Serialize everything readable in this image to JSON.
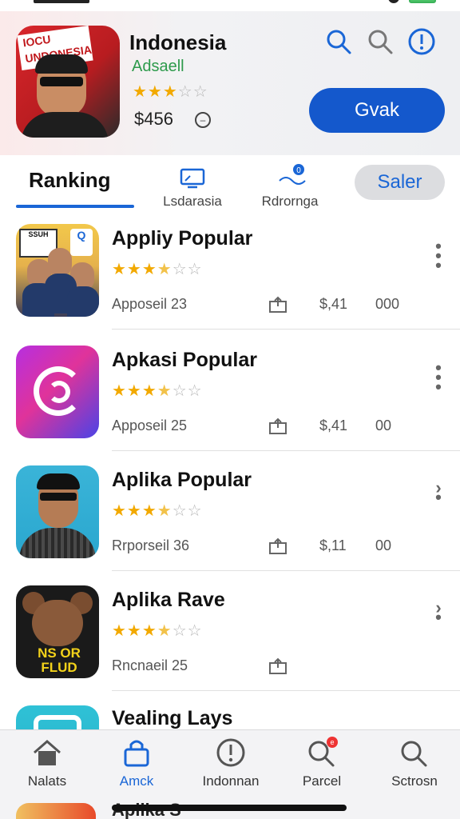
{
  "header": {
    "title": "Indonesia",
    "subtitle": "Adsaell",
    "rating_stars": 3,
    "price": "$456",
    "price_icon": "circle-dash-icon",
    "icon_banner_text": "IOCU UNDONESIA",
    "get_button": "Gvak",
    "icons": [
      "search-icon",
      "search-outline-icon",
      "info-icon"
    ],
    "accent": "#1458cc"
  },
  "tabs": {
    "ranking": "Ranking",
    "tab2": "Lsdarasia",
    "tab3": "Rdrornga",
    "sale": "Saler"
  },
  "list": {
    "items": [
      {
        "title": "Appliy Popular",
        "stars": 3.5,
        "meta": "Apposeil 23",
        "price": "$,41",
        "count": "000",
        "more": "more-vertical-icon"
      },
      {
        "title": "Apkasi Popular",
        "stars": 3.5,
        "meta": "Apposeil 25",
        "price": "$,41",
        "count": "00",
        "more": "more-vertical-icon"
      },
      {
        "title": "Aplika Popular",
        "stars": 3.5,
        "meta": "Rrporseil 36",
        "price": "$,11",
        "count": "00",
        "more": "chevron-more-icon"
      },
      {
        "title": "Aplika Rave",
        "stars": 3.5,
        "meta": "Rncnaeil 25",
        "price": "",
        "count": "",
        "more": "chevron-more-icon",
        "icon_text": "NS OR FLUD"
      },
      {
        "title": "Vealing Lays",
        "stars": 0,
        "meta": "",
        "price": "",
        "count": "",
        "more": ""
      }
    ]
  },
  "thumb1": {
    "sign": "SSUH",
    "q": "Q"
  },
  "nav": {
    "items": [
      {
        "label": "Nalats",
        "icon": "home-icon"
      },
      {
        "label": "Amck",
        "icon": "bag-icon",
        "active": true
      },
      {
        "label": "Indonnan",
        "icon": "info-icon"
      },
      {
        "label": "Parcel",
        "icon": "search-badge-icon"
      },
      {
        "label": "Sctrosn",
        "icon": "search-icon"
      }
    ]
  },
  "peek": {
    "title": "Aplika S"
  }
}
